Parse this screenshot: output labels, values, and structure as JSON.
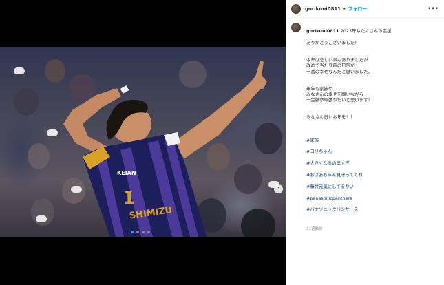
{
  "post": {
    "username": "gorikuni0811",
    "separator": "•",
    "follow_label": "フォロー",
    "more_icon": "more-horizontal-icon"
  },
  "caption": {
    "username": "gorikuni0811",
    "line1": "2023年もたくさんの応援",
    "line2": "ありがとうございました！",
    "para2": "今年は悲しい事もありましたが\n改めて当たり前の日常が\n一番の幸せなんだと思いました。",
    "para3": "来年も家族や\nみなさんの幸せを願いながら\n一生懸命頑張りたいと思います！",
    "para4": "みなさん良いお年を！！",
    "hashtags": [
      "#家族",
      "#コリちゃん",
      "#大きくなるの早すぎ",
      "#おばあちゃん見守っててね",
      "#藤井元気にしてるかい",
      "#panasonicpanthers",
      "#パナソニックパンサーズ"
    ],
    "timestamp": "21週間前"
  },
  "media": {
    "jersey_number": "1",
    "jersey_name": "SHIMIZU",
    "jersey_sponsor": "KEIAN",
    "carousel_dots": 4,
    "active_dot": 0,
    "next_icon": "chevron-right-icon"
  },
  "colors": {
    "follow": "#0095f6",
    "hashtag": "#00376b",
    "jersey_navy": "#1c1f5c",
    "jersey_purple": "#4b3a9a",
    "jersey_gold": "#d9a227"
  }
}
